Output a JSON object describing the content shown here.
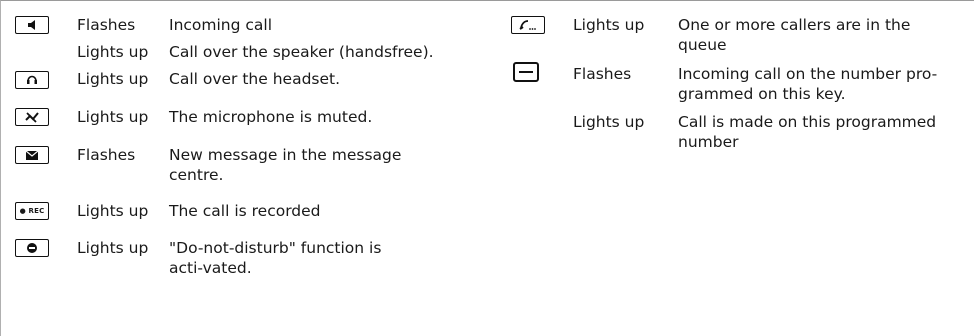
{
  "left_column": [
    {
      "icon": "speaker-icon",
      "status": "Flashes",
      "description": "Incoming call"
    },
    {
      "icon": "",
      "status": "Lights up",
      "description": "Call over the speaker (handsfree)."
    },
    {
      "icon": "headset-icon",
      "status": "Lights up",
      "description": "Call over the headset."
    },
    {
      "icon": "mute-icon",
      "status": "Lights up",
      "description": "The microphone is muted."
    },
    {
      "icon": "message-icon",
      "status": "Flashes",
      "description": "New message in the message centre."
    },
    {
      "icon": "record-icon",
      "icon_text": "● REC",
      "status": "Lights up",
      "description": "The call is recorded"
    },
    {
      "icon": "do-not-disturb-icon",
      "status": "Lights up",
      "description": "\"Do-not-disturb\" function is acti-vated."
    }
  ],
  "right_column": [
    {
      "icon": "call-queue-icon",
      "status": "Lights up",
      "description": "One or more callers are in the queue"
    },
    {
      "icon": "programmable-key-icon",
      "status": "Flashes",
      "description": "Incoming call on the number pro-grammed on this key."
    },
    {
      "icon": "",
      "status": "Lights up",
      "description": "Call is made on this programmed number"
    }
  ]
}
